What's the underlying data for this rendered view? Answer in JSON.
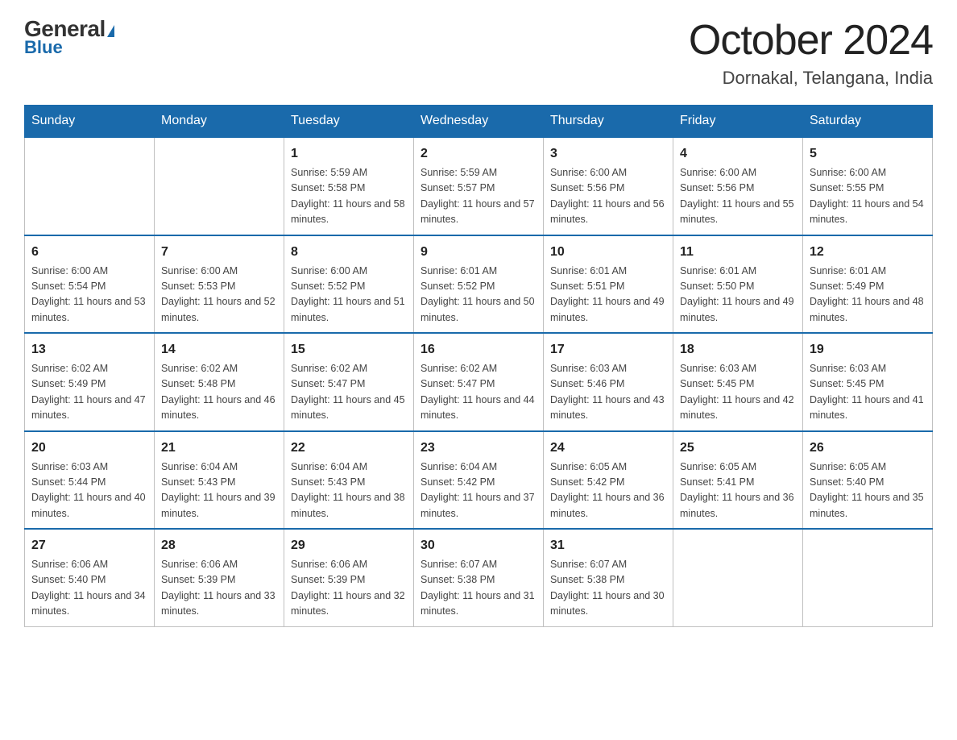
{
  "logo": {
    "general": "General",
    "blue": "Blue"
  },
  "header": {
    "month": "October 2024",
    "location": "Dornakal, Telangana, India"
  },
  "days_of_week": [
    "Sunday",
    "Monday",
    "Tuesday",
    "Wednesday",
    "Thursday",
    "Friday",
    "Saturday"
  ],
  "weeks": [
    [
      {
        "day": "",
        "sunrise": "",
        "sunset": "",
        "daylight": ""
      },
      {
        "day": "",
        "sunrise": "",
        "sunset": "",
        "daylight": ""
      },
      {
        "day": "1",
        "sunrise": "Sunrise: 5:59 AM",
        "sunset": "Sunset: 5:58 PM",
        "daylight": "Daylight: 11 hours and 58 minutes."
      },
      {
        "day": "2",
        "sunrise": "Sunrise: 5:59 AM",
        "sunset": "Sunset: 5:57 PM",
        "daylight": "Daylight: 11 hours and 57 minutes."
      },
      {
        "day": "3",
        "sunrise": "Sunrise: 6:00 AM",
        "sunset": "Sunset: 5:56 PM",
        "daylight": "Daylight: 11 hours and 56 minutes."
      },
      {
        "day": "4",
        "sunrise": "Sunrise: 6:00 AM",
        "sunset": "Sunset: 5:56 PM",
        "daylight": "Daylight: 11 hours and 55 minutes."
      },
      {
        "day": "5",
        "sunrise": "Sunrise: 6:00 AM",
        "sunset": "Sunset: 5:55 PM",
        "daylight": "Daylight: 11 hours and 54 minutes."
      }
    ],
    [
      {
        "day": "6",
        "sunrise": "Sunrise: 6:00 AM",
        "sunset": "Sunset: 5:54 PM",
        "daylight": "Daylight: 11 hours and 53 minutes."
      },
      {
        "day": "7",
        "sunrise": "Sunrise: 6:00 AM",
        "sunset": "Sunset: 5:53 PM",
        "daylight": "Daylight: 11 hours and 52 minutes."
      },
      {
        "day": "8",
        "sunrise": "Sunrise: 6:00 AM",
        "sunset": "Sunset: 5:52 PM",
        "daylight": "Daylight: 11 hours and 51 minutes."
      },
      {
        "day": "9",
        "sunrise": "Sunrise: 6:01 AM",
        "sunset": "Sunset: 5:52 PM",
        "daylight": "Daylight: 11 hours and 50 minutes."
      },
      {
        "day": "10",
        "sunrise": "Sunrise: 6:01 AM",
        "sunset": "Sunset: 5:51 PM",
        "daylight": "Daylight: 11 hours and 49 minutes."
      },
      {
        "day": "11",
        "sunrise": "Sunrise: 6:01 AM",
        "sunset": "Sunset: 5:50 PM",
        "daylight": "Daylight: 11 hours and 49 minutes."
      },
      {
        "day": "12",
        "sunrise": "Sunrise: 6:01 AM",
        "sunset": "Sunset: 5:49 PM",
        "daylight": "Daylight: 11 hours and 48 minutes."
      }
    ],
    [
      {
        "day": "13",
        "sunrise": "Sunrise: 6:02 AM",
        "sunset": "Sunset: 5:49 PM",
        "daylight": "Daylight: 11 hours and 47 minutes."
      },
      {
        "day": "14",
        "sunrise": "Sunrise: 6:02 AM",
        "sunset": "Sunset: 5:48 PM",
        "daylight": "Daylight: 11 hours and 46 minutes."
      },
      {
        "day": "15",
        "sunrise": "Sunrise: 6:02 AM",
        "sunset": "Sunset: 5:47 PM",
        "daylight": "Daylight: 11 hours and 45 minutes."
      },
      {
        "day": "16",
        "sunrise": "Sunrise: 6:02 AM",
        "sunset": "Sunset: 5:47 PM",
        "daylight": "Daylight: 11 hours and 44 minutes."
      },
      {
        "day": "17",
        "sunrise": "Sunrise: 6:03 AM",
        "sunset": "Sunset: 5:46 PM",
        "daylight": "Daylight: 11 hours and 43 minutes."
      },
      {
        "day": "18",
        "sunrise": "Sunrise: 6:03 AM",
        "sunset": "Sunset: 5:45 PM",
        "daylight": "Daylight: 11 hours and 42 minutes."
      },
      {
        "day": "19",
        "sunrise": "Sunrise: 6:03 AM",
        "sunset": "Sunset: 5:45 PM",
        "daylight": "Daylight: 11 hours and 41 minutes."
      }
    ],
    [
      {
        "day": "20",
        "sunrise": "Sunrise: 6:03 AM",
        "sunset": "Sunset: 5:44 PM",
        "daylight": "Daylight: 11 hours and 40 minutes."
      },
      {
        "day": "21",
        "sunrise": "Sunrise: 6:04 AM",
        "sunset": "Sunset: 5:43 PM",
        "daylight": "Daylight: 11 hours and 39 minutes."
      },
      {
        "day": "22",
        "sunrise": "Sunrise: 6:04 AM",
        "sunset": "Sunset: 5:43 PM",
        "daylight": "Daylight: 11 hours and 38 minutes."
      },
      {
        "day": "23",
        "sunrise": "Sunrise: 6:04 AM",
        "sunset": "Sunset: 5:42 PM",
        "daylight": "Daylight: 11 hours and 37 minutes."
      },
      {
        "day": "24",
        "sunrise": "Sunrise: 6:05 AM",
        "sunset": "Sunset: 5:42 PM",
        "daylight": "Daylight: 11 hours and 36 minutes."
      },
      {
        "day": "25",
        "sunrise": "Sunrise: 6:05 AM",
        "sunset": "Sunset: 5:41 PM",
        "daylight": "Daylight: 11 hours and 36 minutes."
      },
      {
        "day": "26",
        "sunrise": "Sunrise: 6:05 AM",
        "sunset": "Sunset: 5:40 PM",
        "daylight": "Daylight: 11 hours and 35 minutes."
      }
    ],
    [
      {
        "day": "27",
        "sunrise": "Sunrise: 6:06 AM",
        "sunset": "Sunset: 5:40 PM",
        "daylight": "Daylight: 11 hours and 34 minutes."
      },
      {
        "day": "28",
        "sunrise": "Sunrise: 6:06 AM",
        "sunset": "Sunset: 5:39 PM",
        "daylight": "Daylight: 11 hours and 33 minutes."
      },
      {
        "day": "29",
        "sunrise": "Sunrise: 6:06 AM",
        "sunset": "Sunset: 5:39 PM",
        "daylight": "Daylight: 11 hours and 32 minutes."
      },
      {
        "day": "30",
        "sunrise": "Sunrise: 6:07 AM",
        "sunset": "Sunset: 5:38 PM",
        "daylight": "Daylight: 11 hours and 31 minutes."
      },
      {
        "day": "31",
        "sunrise": "Sunrise: 6:07 AM",
        "sunset": "Sunset: 5:38 PM",
        "daylight": "Daylight: 11 hours and 30 minutes."
      },
      {
        "day": "",
        "sunrise": "",
        "sunset": "",
        "daylight": ""
      },
      {
        "day": "",
        "sunrise": "",
        "sunset": "",
        "daylight": ""
      }
    ]
  ]
}
